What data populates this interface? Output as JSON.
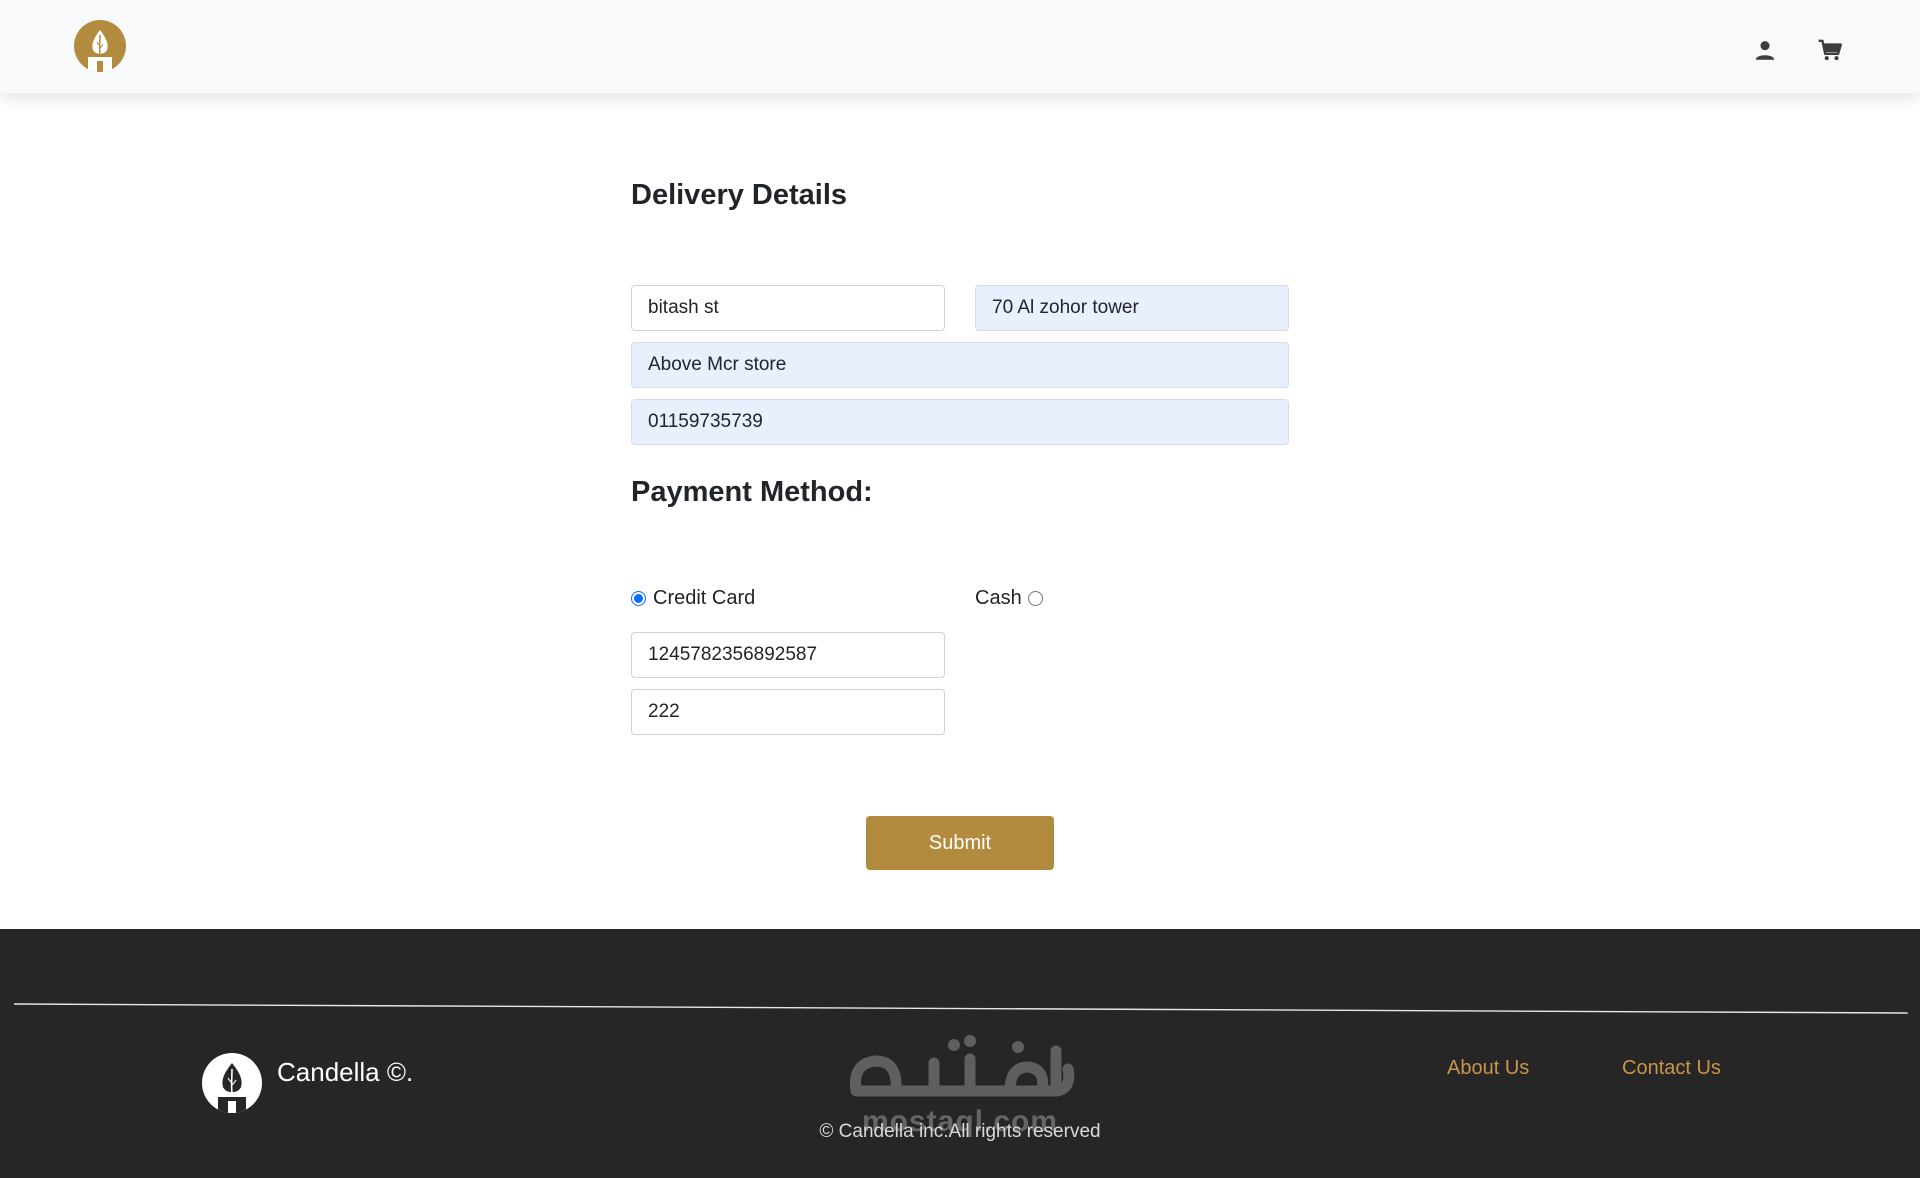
{
  "header": {
    "logo_icon": "candle-flame-logo-icon",
    "user_icon": "user-icon",
    "cart_icon": "cart-icon",
    "brand_color": "#b38b3f"
  },
  "delivery": {
    "title": "Delivery Details",
    "street": "bitash st",
    "building": "70 Al zohor tower",
    "landmark": "Above Mcr store",
    "phone": "01159735739"
  },
  "payment": {
    "title": "Payment Method:",
    "credit_label": "Credit Card",
    "cash_label": "Cash",
    "selected": "credit",
    "card_number": "1245782356892587",
    "cvv": "222"
  },
  "submit_label": "Submit",
  "footer": {
    "brand": "Candella ©.",
    "about": "About Us",
    "contact": "Contact Us",
    "copyright": "© Candella inc.All rights reserved",
    "watermark_text": "mostaql.com",
    "link_color": "#c79649",
    "background": "#262626"
  }
}
